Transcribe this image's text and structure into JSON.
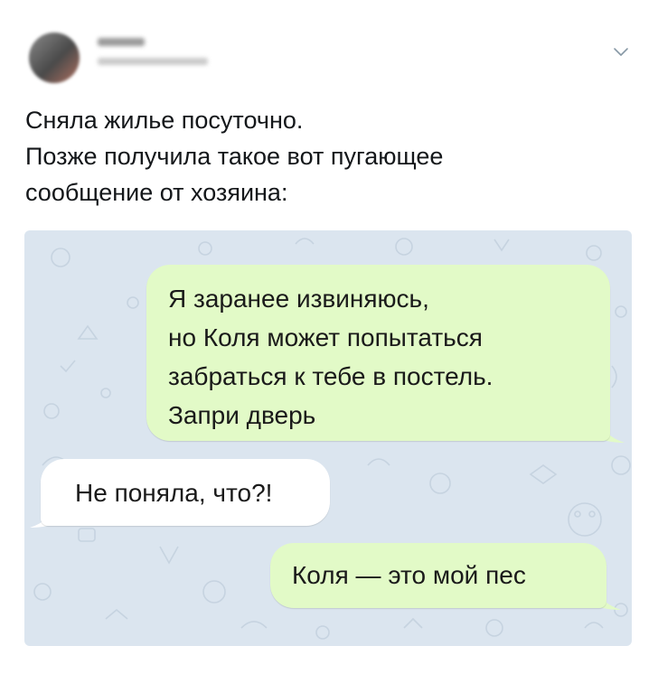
{
  "header": {
    "menu_icon": "chevron-down-icon"
  },
  "tweet": {
    "lines": [
      "Сняла жилье посуточно.",
      "Позже получила такое вот пугающее",
      "сообщение от хозяина:"
    ]
  },
  "chat": {
    "colors": {
      "background": "#dbe5ef",
      "outgoing": "#e2fac7",
      "incoming": "#ffffff"
    },
    "messages": [
      {
        "direction": "outgoing",
        "lines": [
          "Я заранее извиняюсь,",
          "но Коля может попытаться",
          "забраться к тебе в постель.",
          "Запри дверь"
        ]
      },
      {
        "direction": "incoming",
        "lines": [
          "Не поняла, что?!"
        ]
      },
      {
        "direction": "outgoing",
        "lines": [
          "Коля — это мой пес"
        ]
      }
    ]
  }
}
